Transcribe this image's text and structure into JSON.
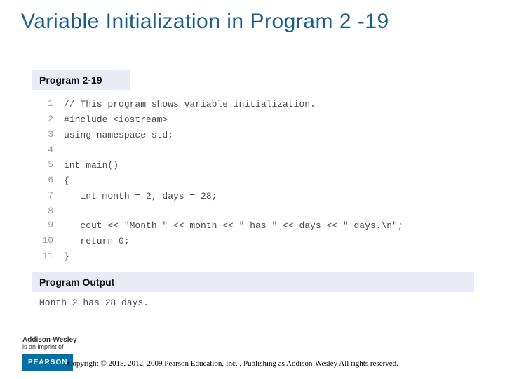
{
  "title": "Variable Initialization in Program 2 -19",
  "program": {
    "header": "Program 2-19",
    "lines": [
      {
        "n": "1",
        "c": "// This program shows variable initialization."
      },
      {
        "n": "2",
        "c": "#include <iostream>"
      },
      {
        "n": "3",
        "c": "using namespace std;"
      },
      {
        "n": "4",
        "c": ""
      },
      {
        "n": "5",
        "c": "int main()"
      },
      {
        "n": "6",
        "c": "{"
      },
      {
        "n": "7",
        "c": "   int month = 2, days = 28;"
      },
      {
        "n": "8",
        "c": ""
      },
      {
        "n": "9",
        "c": "   cout << \"Month \" << month << \" has \" << days << \" days.\\n\";"
      },
      {
        "n": "10",
        "c": "   return 0;"
      },
      {
        "n": "11",
        "c": "}"
      }
    ]
  },
  "output": {
    "header": "Program Output",
    "text": "Month 2 has 28 days."
  },
  "brand": {
    "name": "Addison-Wesley",
    "tagline": "is an imprint of",
    "logo": "PEARSON"
  },
  "copyright": "Copyright © 2015, 2012, 2009 Pearson Education, Inc. , Publishing as Addison-Wesley All rights reserved."
}
